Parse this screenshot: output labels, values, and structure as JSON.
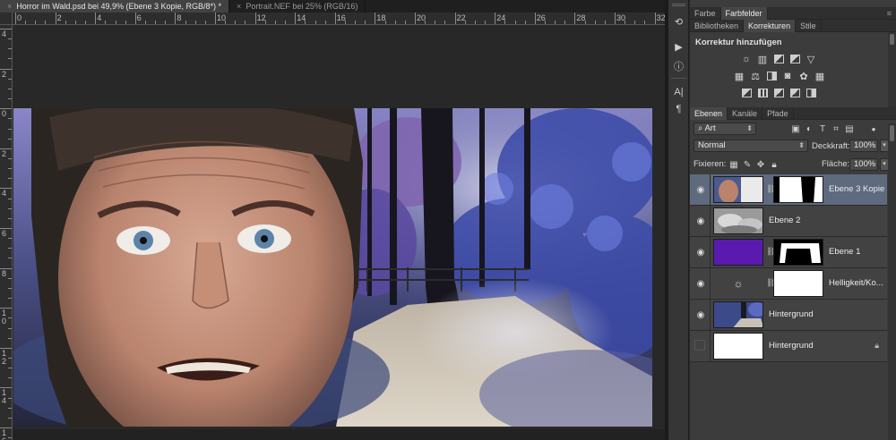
{
  "document_tabs": [
    {
      "label": "Horror im Wald.psd bei 49,9% (Ebene 3 Kopie, RGB/8*) *",
      "active": true
    },
    {
      "label": "Portrait.NEF bei 25% (RGB/16)",
      "active": false
    }
  ],
  "ruler": {
    "top_numbers": [
      "0",
      "2",
      "4",
      "6",
      "8",
      "10",
      "12",
      "14",
      "16",
      "18",
      "20",
      "22",
      "24",
      "26",
      "28",
      "30",
      "32"
    ],
    "left_numbers": [
      "4",
      "2",
      "0",
      "2",
      "4",
      "6",
      "8",
      "10",
      "12",
      "14",
      "16"
    ]
  },
  "tool_strip": {
    "icons": [
      "history-icon",
      "actions-icon",
      "info-icon",
      "character-icon",
      "paragraph-icon"
    ],
    "glyphs": [
      "⟲",
      "▶",
      "ⓘ",
      "A|",
      "¶"
    ]
  },
  "panel_color": {
    "tabs": [
      "Farbe",
      "Farbfelder"
    ],
    "active": "Farbfelder"
  },
  "panel_adjust": {
    "tabs": [
      "Bibliotheken",
      "Korrekturen",
      "Stile"
    ],
    "active": "Korrekturen",
    "title": "Korrektur hinzufügen"
  },
  "panel_layers": {
    "tabs": [
      "Ebenen",
      "Kanäle",
      "Pfade"
    ],
    "active": "Ebenen",
    "filter_kind": "Art",
    "blend_mode": "Normal",
    "opacity_label": "Deckkraft:",
    "opacity_value": "100%",
    "lock_label": "Fixieren:",
    "fill_label": "Fläche:",
    "fill_value": "100%",
    "layers": [
      {
        "name": "Ebene 3 Kopie",
        "visible": true,
        "selected": true
      },
      {
        "name": "Ebene 2",
        "visible": true,
        "selected": false
      },
      {
        "name": "Ebene 1",
        "visible": true,
        "selected": false
      },
      {
        "name": "Helligkeit/Ko...",
        "visible": true,
        "selected": false
      },
      {
        "name": "Hintergrund",
        "visible": true,
        "selected": false
      },
      {
        "name": "Hintergrund",
        "visible": false,
        "selected": false,
        "locked": true
      }
    ]
  },
  "colors": {
    "selected_layer": "#5e6a7e",
    "ebene1_fill": "#5a1ab0",
    "panel_bg": "#3c3c3c"
  }
}
